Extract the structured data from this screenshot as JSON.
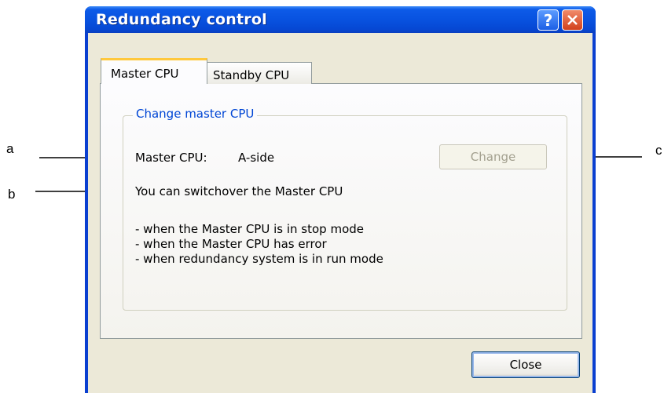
{
  "callouts": {
    "a": "a",
    "b": "b",
    "c": "c"
  },
  "window": {
    "title": "Redundancy control",
    "help_button": "?",
    "close_button": "✕"
  },
  "tabs": [
    {
      "label": "Master CPU",
      "selected": true
    },
    {
      "label": "Standby CPU",
      "selected": false
    }
  ],
  "group": {
    "legend": "Change master CPU",
    "master_cpu_label": "Master CPU:",
    "master_cpu_value": "A-side",
    "change_button": "Change",
    "switchover_text": "You can switchover the Master CPU",
    "conditions": [
      "- when the Master CPU is in stop mode",
      "- when the Master CPU has error",
      "- when redundancy system is in run mode"
    ]
  },
  "footer": {
    "close_button": "Close"
  },
  "colors": {
    "title_bar": "#0852e0",
    "legend_text": "#0046d5",
    "tab_highlight": "#ffc83c"
  }
}
